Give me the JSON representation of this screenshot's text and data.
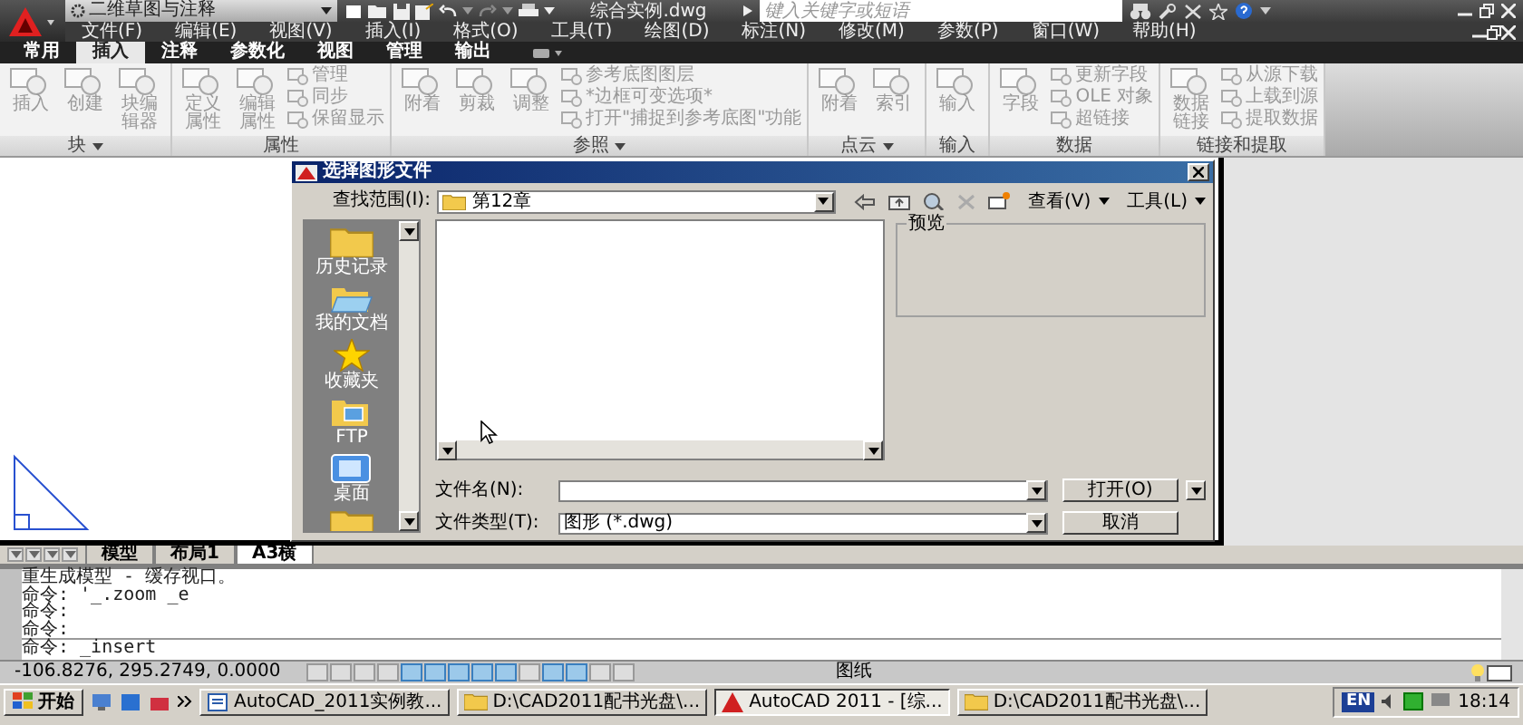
{
  "app_title": {
    "workspace": "二维草图与注释",
    "document": "综合实例.dwg",
    "search_placeholder": "键入关键字或短语"
  },
  "menu": [
    "文件(F)",
    "编辑(E)",
    "视图(V)",
    "插入(I)",
    "格式(O)",
    "工具(T)",
    "绘图(D)",
    "标注(N)",
    "修改(M)",
    "参数(P)",
    "窗口(W)",
    "帮助(H)"
  ],
  "ribbon_tabs": [
    {
      "label": "常用",
      "selected": false
    },
    {
      "label": "插入",
      "selected": true
    },
    {
      "label": "注释",
      "selected": false
    },
    {
      "label": "参数化",
      "selected": false
    },
    {
      "label": "视图",
      "selected": false
    },
    {
      "label": "管理",
      "selected": false
    },
    {
      "label": "输出",
      "selected": false
    }
  ],
  "ribbon_panels": [
    {
      "title": "块",
      "has_menu": true,
      "items": [
        {
          "kind": "large",
          "label": "插入"
        },
        {
          "kind": "large",
          "label": "创建"
        },
        {
          "kind": "large",
          "label": "块编辑器"
        }
      ]
    },
    {
      "title": "属性",
      "has_menu": false,
      "items": [
        {
          "kind": "large",
          "label": "定义属性"
        },
        {
          "kind": "large",
          "label": "编辑属性"
        },
        {
          "kind": "small",
          "label": "管理"
        },
        {
          "kind": "small",
          "label": "同步"
        },
        {
          "kind": "small",
          "label": "保留显示"
        }
      ]
    },
    {
      "title": "参照",
      "has_menu": true,
      "items": [
        {
          "kind": "large",
          "label": "附着"
        },
        {
          "kind": "large",
          "label": "剪裁"
        },
        {
          "kind": "large",
          "label": "调整"
        },
        {
          "kind": "small",
          "label": "参考底图图层"
        },
        {
          "kind": "small",
          "label": "*边框可变选项*"
        },
        {
          "kind": "small",
          "label": "打开\"捕捉到参考底图\"功能"
        }
      ]
    },
    {
      "title": "点云",
      "has_menu": true,
      "items": [
        {
          "kind": "large",
          "label": "附着"
        },
        {
          "kind": "large",
          "label": "索引"
        }
      ]
    },
    {
      "title": "输入",
      "has_menu": false,
      "items": [
        {
          "kind": "large",
          "label": "输入"
        }
      ]
    },
    {
      "title": "数据",
      "has_menu": false,
      "items": [
        {
          "kind": "large",
          "label": "字段"
        },
        {
          "kind": "small",
          "label": "更新字段"
        },
        {
          "kind": "small",
          "label": "OLE 对象"
        },
        {
          "kind": "small",
          "label": "超链接"
        }
      ]
    },
    {
      "title": "链接和提取",
      "has_menu": false,
      "items": [
        {
          "kind": "large",
          "label": "数据链接"
        },
        {
          "kind": "small",
          "label": "从源下载"
        },
        {
          "kind": "small",
          "label": "上载到源"
        },
        {
          "kind": "small",
          "label": "提取数据"
        }
      ]
    }
  ],
  "dialog": {
    "title": "选择图形文件",
    "look_in_label": "查找范围(I):",
    "look_in_value": "第12章",
    "view_menu": "查看(V)",
    "tools_menu": "工具(L)",
    "places": [
      {
        "kind": "folder",
        "label": "历史记录"
      },
      {
        "kind": "documents",
        "label": "我的文档"
      },
      {
        "kind": "star",
        "label": "收藏夹"
      },
      {
        "kind": "ftp",
        "label": "FTP"
      },
      {
        "kind": "desktop",
        "label": "桌面"
      },
      {
        "kind": "folder"
      }
    ],
    "preview_label": "预览",
    "file_name_label": "文件名(N):",
    "file_type_label": "文件类型(T):",
    "file_type_value": "图形 (*.dwg)",
    "open_button": "打开(O)",
    "cancel_button": "取消"
  },
  "layout_tabs": [
    {
      "label": "模型",
      "selected": false
    },
    {
      "label": "布局1",
      "selected": false
    },
    {
      "label": "A3横",
      "selected": true
    }
  ],
  "command_history": [
    "重生成模型 - 缓存视口。",
    "命令: '_.zoom _e",
    "命令:",
    "命令:"
  ],
  "command_prompt": "命令: _insert",
  "status_bar": {
    "coordinates": "-106.8276, 295.2749, 0.0000",
    "paper_label": "图纸",
    "toggles": [
      {
        "on": false
      },
      {
        "on": false
      },
      {
        "on": false
      },
      {
        "on": false
      },
      {
        "on": true
      },
      {
        "on": true
      },
      {
        "on": true
      },
      {
        "on": true
      },
      {
        "on": true
      },
      {
        "on": false
      },
      {
        "on": true
      },
      {
        "on": true
      },
      {
        "on": false
      },
      {
        "on": false
      }
    ]
  },
  "taskbar": {
    "start": "开始",
    "buttons": [
      {
        "kind": "document",
        "label": "AutoCAD_2011实例教...",
        "selected": false
      },
      {
        "kind": "folder",
        "label": "D:\\CAD2011配书光盘\\...",
        "selected": false
      },
      {
        "kind": "autocad",
        "label": "AutoCAD 2011 - [综...",
        "selected": true
      },
      {
        "kind": "folder",
        "label": "D:\\CAD2011配书光盘\\...",
        "selected": false
      }
    ],
    "language": "EN",
    "clock": "18:14"
  }
}
